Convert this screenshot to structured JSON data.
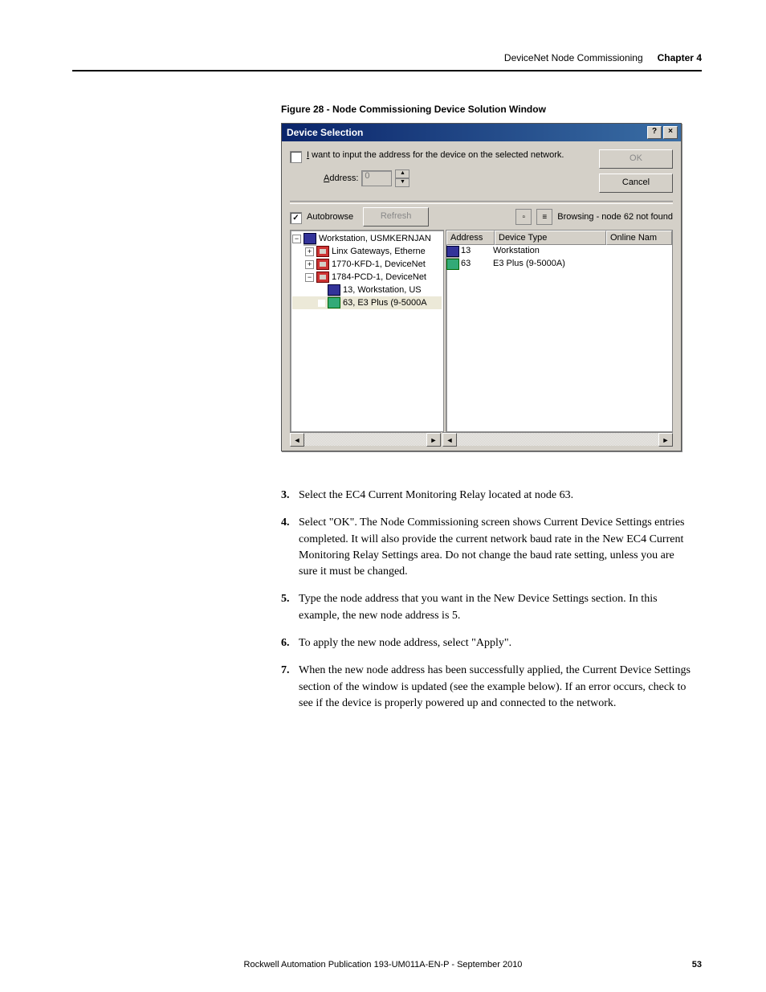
{
  "header": {
    "title": "DeviceNet Node Commissioning",
    "chapter": "Chapter 4"
  },
  "figure": {
    "caption": "Figure 28 - Node Commissioning Device Solution Window"
  },
  "dialog": {
    "title": "Device Selection",
    "help_btn": "?",
    "close_btn": "×",
    "chk_label_before": "I",
    "chk_label_after": " want to input the address for the device on the selected network.",
    "address_label_prefix": "A",
    "address_label_rest": "ddress:",
    "address_value": "0",
    "ok": "OK",
    "cancel": "Cancel",
    "autobrowse": "Autobrowse",
    "refresh": "Refresh",
    "status": "Browsing - node 62 not found",
    "tree": {
      "root": "Workstation, USMKERNJAN",
      "n1": "Linx Gateways, Etherne",
      "n2": "1770-KFD-1, DeviceNet",
      "n3": "1784-PCD-1, DeviceNet",
      "n3a": "13, Workstation, US",
      "n3b": "63, E3 Plus (9-5000A"
    },
    "list": {
      "h_addr": "Address",
      "h_type": "Device Type",
      "h_name": "Online Nam",
      "r1_addr": "13",
      "r1_type": "Workstation",
      "r2_addr": "63",
      "r2_type": "E3 Plus (9-5000A)"
    }
  },
  "steps": {
    "s3n": "3.",
    "s3": "Select the EC4 Current Monitoring Relay located at node 63.",
    "s4n": "4.",
    "s4": "Select \"OK\". The Node Commissioning screen shows Current Device Settings entries completed. It will also provide the current network baud rate in the New EC4 Current Monitoring Relay Settings area. Do not change the baud rate setting, unless you are sure it must be changed.",
    "s5n": "5.",
    "s5": "Type the node address that you want in the New Device Settings section. In this example, the new node address is 5.",
    "s6n": "6.",
    "s6": "To apply the new node address, select \"Apply\".",
    "s7n": "7.",
    "s7": "When the new node address has been successfully applied, the Current Device Settings section of the window is updated (see the example below). If an error occurs, check to see if the device is properly powered up and connected to the network."
  },
  "footer": {
    "pub": "Rockwell Automation Publication 193-UM011A-EN-P - September 2010",
    "page": "53"
  }
}
